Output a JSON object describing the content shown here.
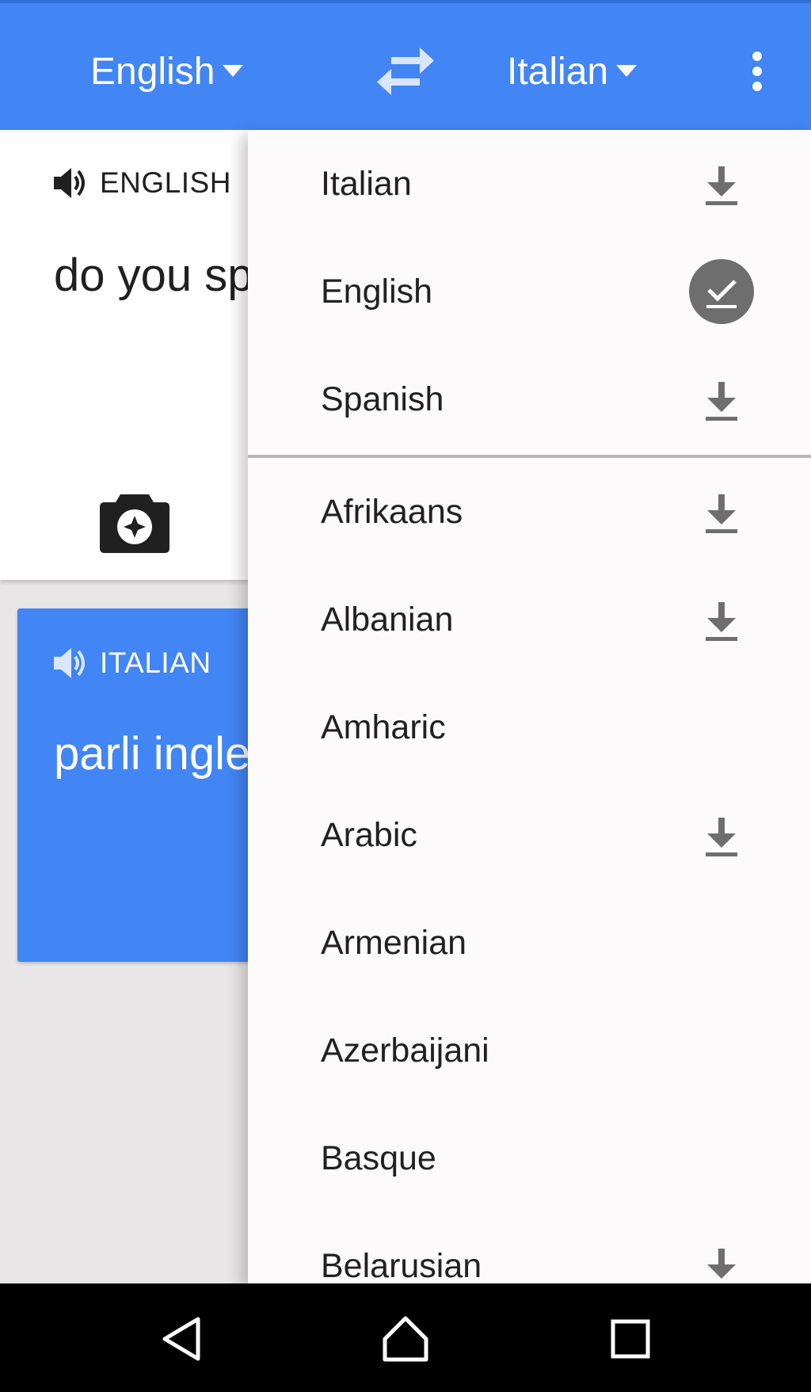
{
  "header": {
    "source_language": "English",
    "target_language": "Italian",
    "icons": {
      "source_caret": "caret-down-icon",
      "swap": "swap-languages-icon",
      "target_caret": "caret-down-icon",
      "more": "more-vert-icon"
    }
  },
  "source_card": {
    "language_label": "ENGLISH",
    "text": "do you sp",
    "icons": {
      "speaker": "speaker-icon",
      "camera": "camera-icon"
    }
  },
  "target_card": {
    "language_label": "ITALIAN",
    "text": "parli ingle",
    "icons": {
      "speaker": "speaker-icon"
    }
  },
  "language_menu": {
    "recent": [
      {
        "label": "Italian",
        "status": "download"
      },
      {
        "label": "English",
        "status": "downloaded"
      },
      {
        "label": "Spanish",
        "status": "download"
      }
    ],
    "all": [
      {
        "label": "Afrikaans",
        "status": "download"
      },
      {
        "label": "Albanian",
        "status": "download"
      },
      {
        "label": "Amharic",
        "status": "none"
      },
      {
        "label": "Arabic",
        "status": "download"
      },
      {
        "label": "Armenian",
        "status": "none"
      },
      {
        "label": "Azerbaijani",
        "status": "none"
      },
      {
        "label": "Basque",
        "status": "none"
      },
      {
        "label": "Belarusian",
        "status": "download"
      }
    ]
  },
  "navbar": {
    "icons": {
      "back": "back-icon",
      "home": "home-icon",
      "recents": "recents-icon"
    }
  },
  "colors": {
    "primary": "#4285f4",
    "menu_background": "#fcfafa",
    "icon_gray": "#6e6e6e",
    "navbar": "#000000"
  }
}
